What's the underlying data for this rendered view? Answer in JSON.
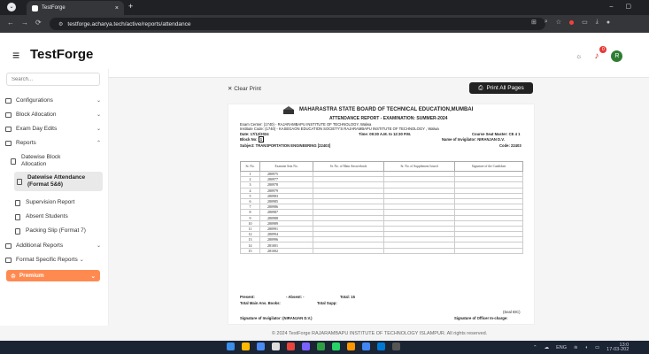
{
  "browser": {
    "tab_title": "TestForge",
    "new_tab": "+",
    "url": "testforge.acharya.tech/active/reports/attendance"
  },
  "app": {
    "brand": "TestForge",
    "notification_count": "0",
    "avatar_initial": "R"
  },
  "sidebar": {
    "search_placeholder": "Search...",
    "items": [
      {
        "label": "Configurations"
      },
      {
        "label": "Block Allocation"
      },
      {
        "label": "Exam Day Edits"
      },
      {
        "label": "Reports"
      }
    ],
    "report_subitems": [
      {
        "label": "Datewise Block Allocation"
      },
      {
        "label": "Datewise Attendance (Format 5&6)"
      },
      {
        "label": "Supervision Report"
      },
      {
        "label": "Absent Students"
      },
      {
        "label": "Packing Slip (Format 7)"
      }
    ],
    "additional": "Additional Reports",
    "format_specific": "Format Specific Reports",
    "premium": "Premium"
  },
  "toolbar": {
    "clear_print": "Clear Print",
    "print_all": "Print All Pages"
  },
  "report": {
    "board": "MAHARASTRA STATE BOARD OF TECHNICAL EDUCATION,MUMBAI",
    "title": "ATTENDANCE REPORT - EXAMINATION: SUMMER-2024",
    "exam_centre": "Exam Center: (1740) - RAJARAMBAPU INSTITUTE OF TECHNOLOGY, Walwa",
    "institute_code": "Institute Code: (1740) - KASEGAON EDUCATION SOCIETY'S RAJARAMBAPU INSTITUTE OF TECHNOLOGY , Walwa",
    "date": "Date: 17/12/2024",
    "time": "Time: 09:30 A.M. to 12:30 P.M.",
    "course_seat": "Course Seat Master: CE 4 1",
    "block_no_label": "Block No:",
    "block_no": "1",
    "invigilator": "Name of Invigilator: NIRANJAN D.V.",
    "subject": "Subject: TRANSPORTATION ENGINEERING [22403]",
    "code": "Code: 22403",
    "headers": [
      "Sr. No.",
      "Examine Seat No.",
      "Sr. No. of Main Answerbook",
      "Sr. No. of Supplement Issued",
      "Signature of the Candidate"
    ],
    "rows": [
      {
        "sr": "1",
        "seat": "280975"
      },
      {
        "sr": "2",
        "seat": "280977"
      },
      {
        "sr": "3",
        "seat": "280978"
      },
      {
        "sr": "4",
        "seat": "280979"
      },
      {
        "sr": "5",
        "seat": "280983"
      },
      {
        "sr": "6",
        "seat": "280985"
      },
      {
        "sr": "7",
        "seat": "280986"
      },
      {
        "sr": "8",
        "seat": "280987"
      },
      {
        "sr": "9",
        "seat": "280988"
      },
      {
        "sr": "10",
        "seat": "280989"
      },
      {
        "sr": "11",
        "seat": "280991"
      },
      {
        "sr": "12",
        "seat": "280994"
      },
      {
        "sr": "13",
        "seat": "280996"
      },
      {
        "sr": "14",
        "seat": "281001"
      },
      {
        "sr": "15",
        "seat": "281002"
      }
    ],
    "present": "Present:",
    "absent": "- Absent: -",
    "total": "Total: 15",
    "total_main": "Total Main Ans. Books:",
    "total_supp": "Total Supp:",
    "seal": "(Seal IDC)",
    "sig_invigilator": "Signature of Invigilator: (NIRANJAN D.V.)",
    "sig_officer": "Signature of Officer In-charge:"
  },
  "footer": "© 2024 TestForge RAJARAMBAPU INSTITUTE OF TECHNOLOGY ISLAMPUR. All rights reserved.",
  "taskbar": {
    "lang": "ENG",
    "time": "13:0",
    "date": "17-03-202"
  }
}
